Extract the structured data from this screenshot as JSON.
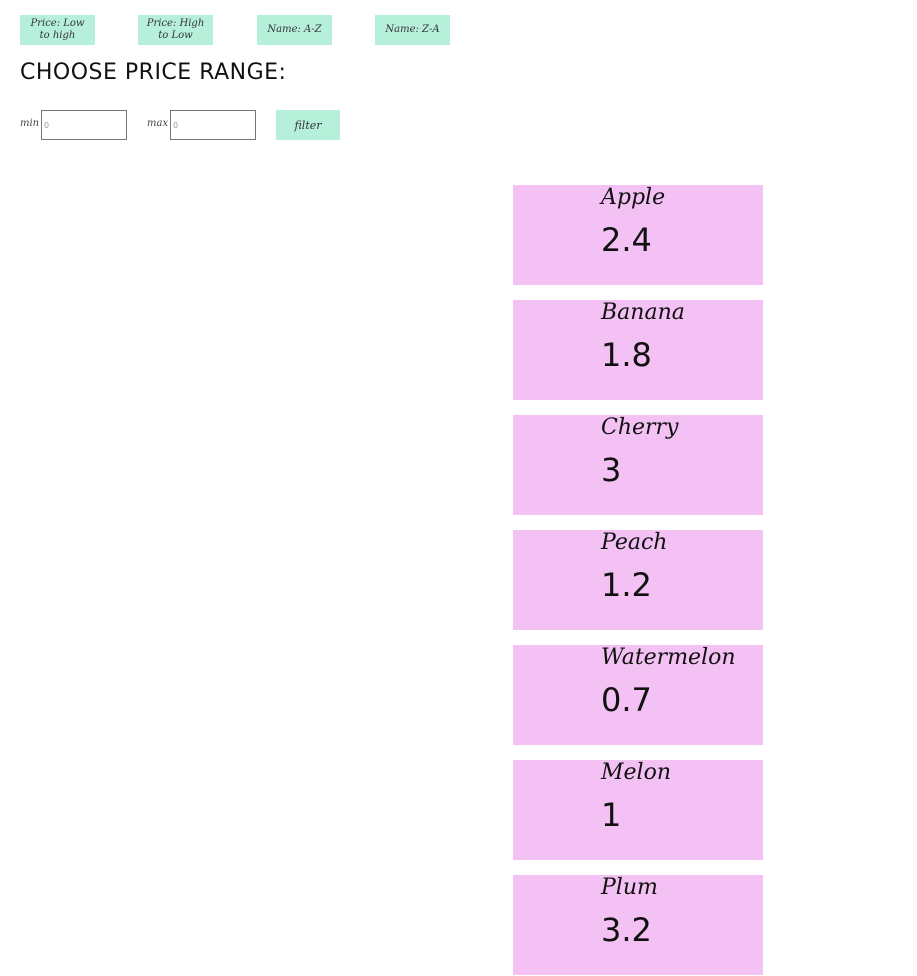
{
  "sort_buttons": [
    {
      "label": "Price: Low to high"
    },
    {
      "label": "Price: High to Low"
    },
    {
      "label": "Name: A-Z"
    },
    {
      "label": "Name: Z-A"
    }
  ],
  "range": {
    "title": "CHOOSE PRICE RANGE:",
    "min_label": "min",
    "min_value": "0",
    "max_label": "max",
    "max_value": "0",
    "filter_label": "filter"
  },
  "products": [
    {
      "name": "Apple",
      "price": "2.4"
    },
    {
      "name": "Banana",
      "price": "1.8"
    },
    {
      "name": "Cherry",
      "price": "3"
    },
    {
      "name": "Peach",
      "price": "1.2"
    },
    {
      "name": "Watermelon",
      "price": "0.7"
    },
    {
      "name": "Melon",
      "price": "1"
    },
    {
      "name": "Plum",
      "price": "3.2"
    }
  ],
  "colors": {
    "button_bg": "#b6f0db",
    "card_bg": "#f3c1f3"
  }
}
